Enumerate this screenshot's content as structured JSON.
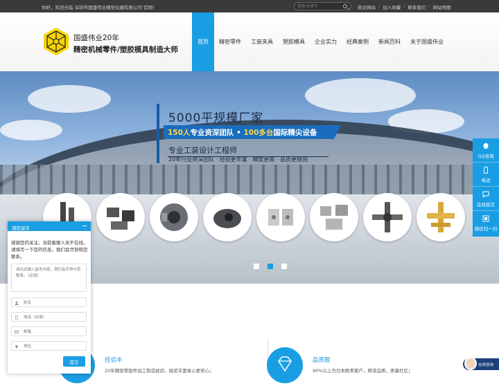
{
  "topbar": {
    "welcome": "你好，欢迎光临 深圳市国盛伟业精密仪器有限公司 官网！",
    "search_placeholder": "搜索关键字",
    "links": [
      "英文网站",
      "加入收藏",
      "联系我们",
      "网站地图"
    ],
    "separator": "|"
  },
  "header": {
    "brand_line1": "国盛伟业20年",
    "brand_line2": "精密机械零件/塑胶模具制造大师",
    "nav": [
      "首页",
      "精密零件",
      "工装夹具",
      "塑胶模具",
      "企业实力",
      "经典案例",
      "新闻百科",
      "关于国盛伟业"
    ],
    "active_index": 0,
    "accent_color": "#1a9ee3"
  },
  "banner": {
    "title": "5000平规模厂家",
    "ribbon_a": "150人",
    "ribbon_b": "专业资深团队 • ",
    "ribbon_c": "100多台",
    "ribbon_d": "国际精尖设备",
    "sub1": "专业工装设计工程师",
    "sub2": "20年行业资深团队 · 经验更丰富 · 精度更高 · 品质更稳固",
    "slides": 3,
    "active_slide": 1
  },
  "right_float": [
    "QQ咨询",
    "电话",
    "在线留言",
    "微信扫一扫"
  ],
  "message": {
    "header": "请您留言",
    "intro": "感谢您的关注，当前客服人员不在线，请填写一下您的信息，我们会尽快和您联系。",
    "textarea_placeholder": "请在此输入留言内容，我们会尽快与您联系。（必填）",
    "fields": [
      "姓名",
      "电话（必填）",
      "邮箱",
      "地址"
    ],
    "submit": "提交"
  },
  "features": [
    {
      "title": "经验丰",
      "desc": "20年精密零配件加工制造经验，经验丰富省心更安心；"
    },
    {
      "title": "品质靓",
      "desc": "90%以上为日本欧美客户，精湛品质，质量杠杠；"
    }
  ],
  "chat_button": "在线咨询"
}
